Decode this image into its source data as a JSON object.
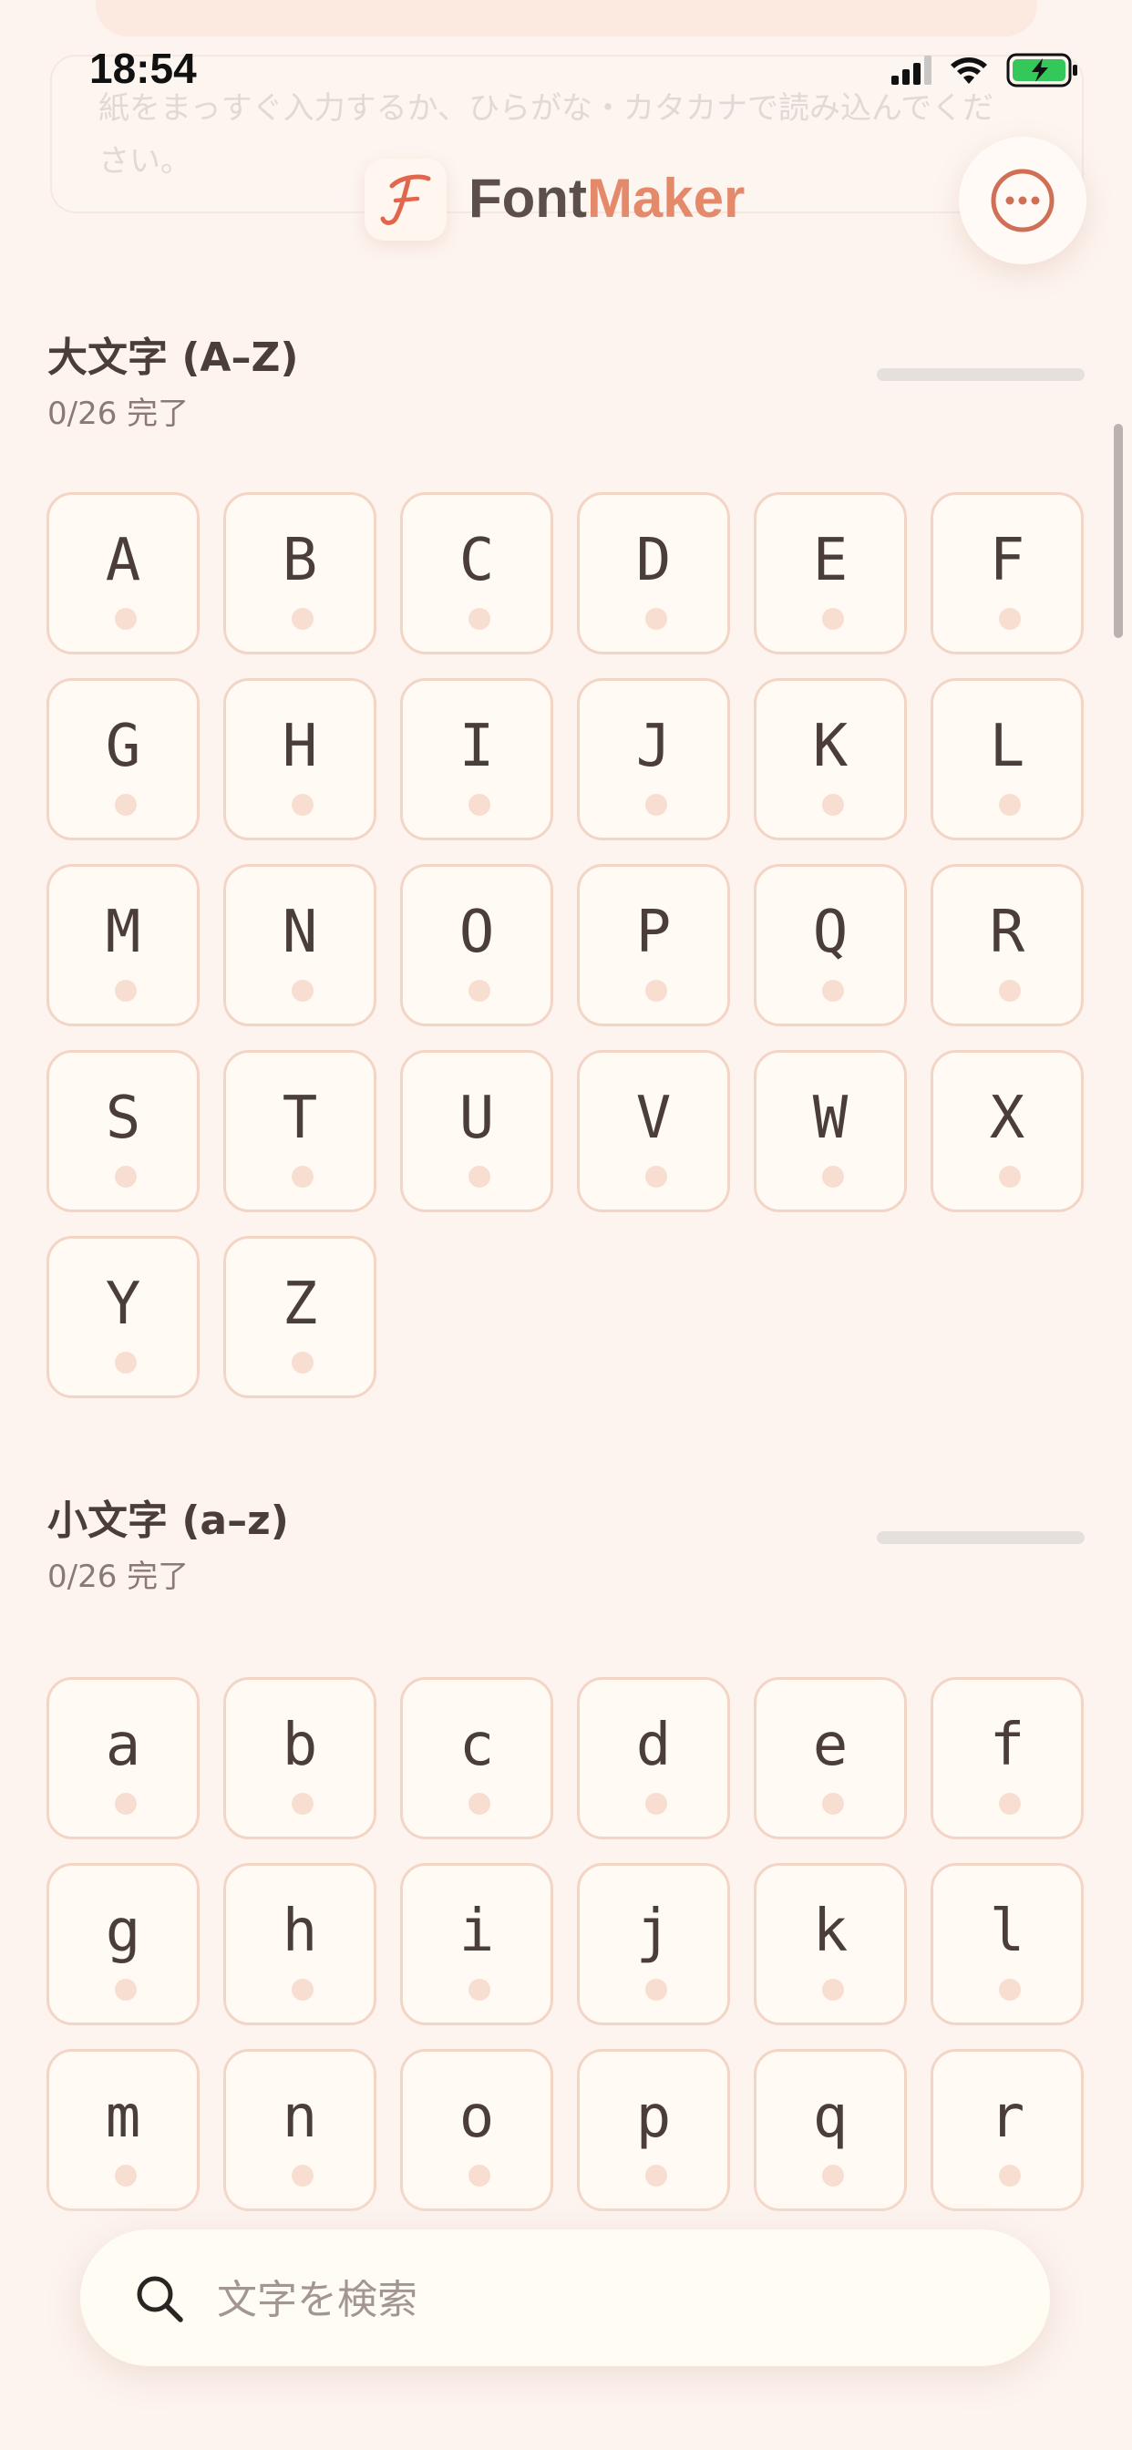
{
  "status_bar": {
    "time": "18:54"
  },
  "background_hint": {
    "text": "紙をまっすぐ入力するか、ひらがな・カタカナで読み込んでください。"
  },
  "header": {
    "brand_part1": "Font",
    "brand_part2": "Maker",
    "logo_letter": "F",
    "more_icon": "ellipsis-circle-icon"
  },
  "sections": [
    {
      "title": "大文字 (A–Z)",
      "count": "0/26 完了",
      "progress": 0,
      "characters": [
        "A",
        "B",
        "C",
        "D",
        "E",
        "F",
        "G",
        "H",
        "I",
        "J",
        "K",
        "L",
        "M",
        "N",
        "O",
        "P",
        "Q",
        "R",
        "S",
        "T",
        "U",
        "V",
        "W",
        "X",
        "Y",
        "Z"
      ]
    },
    {
      "title": "小文字 (a–z)",
      "count": "0/26 完了",
      "progress": 0,
      "characters": [
        "a",
        "b",
        "c",
        "d",
        "e",
        "f",
        "g",
        "h",
        "i",
        "j",
        "k",
        "l",
        "m",
        "n",
        "o",
        "p",
        "q",
        "r"
      ]
    }
  ],
  "search": {
    "placeholder": "文字を検索",
    "value": ""
  },
  "colors": {
    "accent": "#e5896b",
    "background": "#fdf4ef",
    "tile_border": "#f3d5c6",
    "tile_dot": "#f8ddd1",
    "text": "#4b3e3a"
  }
}
